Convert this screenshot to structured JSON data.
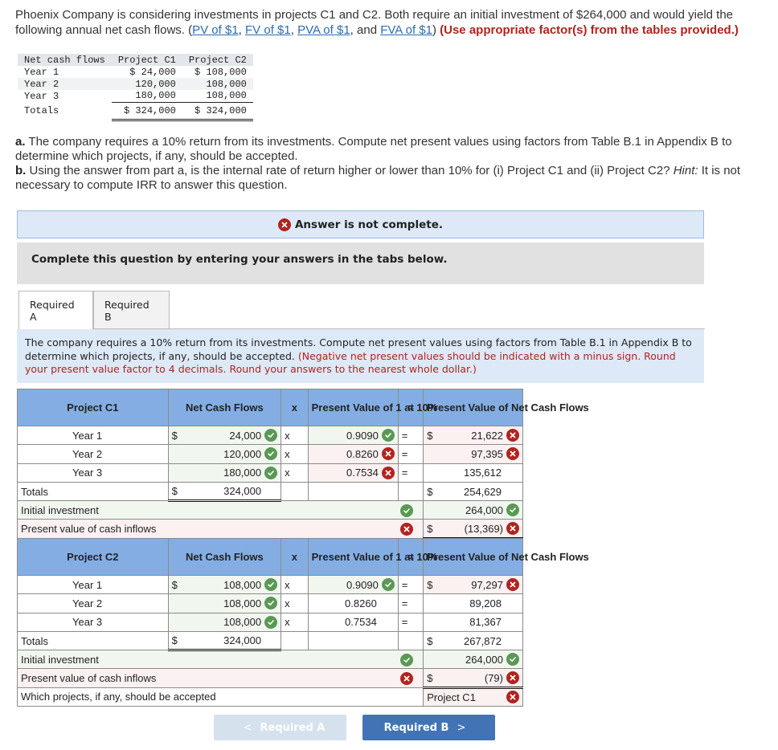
{
  "intro": {
    "text": "Phoenix Company is considering investments in projects C1 and C2. Both require an initial investment of $264,000 and would yield the following annual net cash flows. (",
    "links": [
      "PV of $1",
      "FV of $1",
      "PVA of $1",
      "FVA of $1"
    ],
    "sep1": ", ",
    "sep2": ", ",
    "sep3": ", and ",
    "close": ")",
    "instruction": "(Use appropriate factor(s) from the tables provided.)"
  },
  "cash_flow_table": {
    "headers": [
      "Net cash flows",
      "Project C1",
      "Project C2"
    ],
    "rows": [
      {
        "label": "Year 1",
        "c1": "$ 24,000",
        "c2": "$ 108,000"
      },
      {
        "label": "Year 2",
        "c1": "120,000",
        "c2": "108,000"
      },
      {
        "label": "Year 3",
        "c1": "180,000",
        "c2": "108,000"
      }
    ],
    "totals": {
      "label": "Totals",
      "c1": "$ 324,000",
      "c2": "$ 324,000"
    }
  },
  "questions": {
    "a_label": "a.",
    "a_text": " The company requires a 10% return from its investments. Compute net present values using factors from Table B.1 in Appendix B to determine which projects, if any, should be accepted.",
    "b_label": "b.",
    "b_text": " Using the answer from part a, is the internal rate of return higher or lower than 10% for (i) Project C1 and (ii) Project C2? ",
    "b_hint_label": "Hint:",
    "b_hint": " It is not necessary to compute IRR to answer this question."
  },
  "banner": {
    "status": "Answer is not complete."
  },
  "instruction_box": {
    "text": "Complete this question by entering your answers in the tabs below."
  },
  "tabs": [
    {
      "label": "Required A",
      "active": true
    },
    {
      "label": "Required B",
      "active": false
    }
  ],
  "task": {
    "text": "The company requires a 10% return from its investments. Compute net present values using factors from Table B.1 in Appendix B to determine which projects, if any, should be accepted. ",
    "note": "(Negative net present values should be indicated with a minus sign. Round your present value factor to 4 decimals. Round your answers to the nearest whole dollar.)"
  },
  "npv_headers": {
    "flows": "Net Cash Flows",
    "times": "x",
    "factor": "Present Value of 1 at 10%",
    "equals": "=",
    "pv": "Present Value of Net Cash Flows"
  },
  "project_c1": {
    "title": "Project C1",
    "rows": [
      {
        "label": "Year 1",
        "dollar": "$",
        "flow": "24,000",
        "flow_status": "correct",
        "x": "x",
        "factor": "0.9090",
        "factor_status": "correct",
        "eq": "=",
        "pv_dollar": "$",
        "pv": "21,622",
        "pv_status": "incorrect"
      },
      {
        "label": "Year 2",
        "dollar": "",
        "flow": "120,000",
        "flow_status": "correct",
        "x": "x",
        "factor": "0.8260",
        "factor_status": "incorrect",
        "eq": "=",
        "pv_dollar": "",
        "pv": "97,395",
        "pv_status": "incorrect"
      },
      {
        "label": "Year 3",
        "dollar": "",
        "flow": "180,000",
        "flow_status": "correct",
        "x": "x",
        "factor": "0.7534",
        "factor_status": "incorrect",
        "eq": "=",
        "pv_dollar": "",
        "pv": "135,612",
        "pv_status": "none"
      }
    ],
    "totals": {
      "label": "Totals",
      "dollar": "$",
      "flow": "324,000",
      "pv_dollar": "$",
      "pv": "254,629"
    },
    "initial_investment": {
      "label": "Initial investment",
      "label_status": "correct",
      "value": "264,000",
      "value_status": "correct"
    },
    "pv_inflows": {
      "label": "Present value of cash inflows",
      "label_status": "incorrect",
      "dollar": "$",
      "value": "(13,369)",
      "value_status": "incorrect"
    }
  },
  "project_c2": {
    "title": "Project C2",
    "rows": [
      {
        "label": "Year 1",
        "dollar": "$",
        "flow": "108,000",
        "flow_status": "correct",
        "x": "x",
        "factor": "0.9090",
        "factor_status": "correct",
        "eq": "=",
        "pv_dollar": "$",
        "pv": "97,297",
        "pv_status": "incorrect"
      },
      {
        "label": "Year 2",
        "dollar": "",
        "flow": "108,000",
        "flow_status": "correct",
        "x": "x",
        "factor": "0.8260",
        "factor_status": "none",
        "eq": "=",
        "pv_dollar": "",
        "pv": "89,208",
        "pv_status": "none"
      },
      {
        "label": "Year 3",
        "dollar": "",
        "flow": "108,000",
        "flow_status": "correct",
        "x": "x",
        "factor": "0.7534",
        "factor_status": "none",
        "eq": "=",
        "pv_dollar": "",
        "pv": "81,367",
        "pv_status": "none"
      }
    ],
    "totals": {
      "label": "Totals",
      "dollar": "$",
      "flow": "324,000",
      "pv_dollar": "$",
      "pv": "267,872"
    },
    "initial_investment": {
      "label": "Initial investment",
      "label_status": "correct",
      "value": "264,000",
      "value_status": "correct"
    },
    "pv_inflows": {
      "label": "Present value of cash inflows",
      "label_status": "incorrect",
      "dollar": "$",
      "value": "(79)",
      "value_status": "incorrect"
    },
    "decision": {
      "label": "Which projects, if any, should be accepted",
      "value": "Project C1",
      "value_status": "incorrect"
    }
  },
  "navigation": {
    "prev": "Required A",
    "next": "Required B",
    "prev_enabled": false,
    "next_enabled": true
  },
  "colors": {
    "correct": "#5a9955",
    "incorrect": "#b0241f",
    "header_blue": "#84aee3",
    "accent_blue": "#4274b5"
  }
}
